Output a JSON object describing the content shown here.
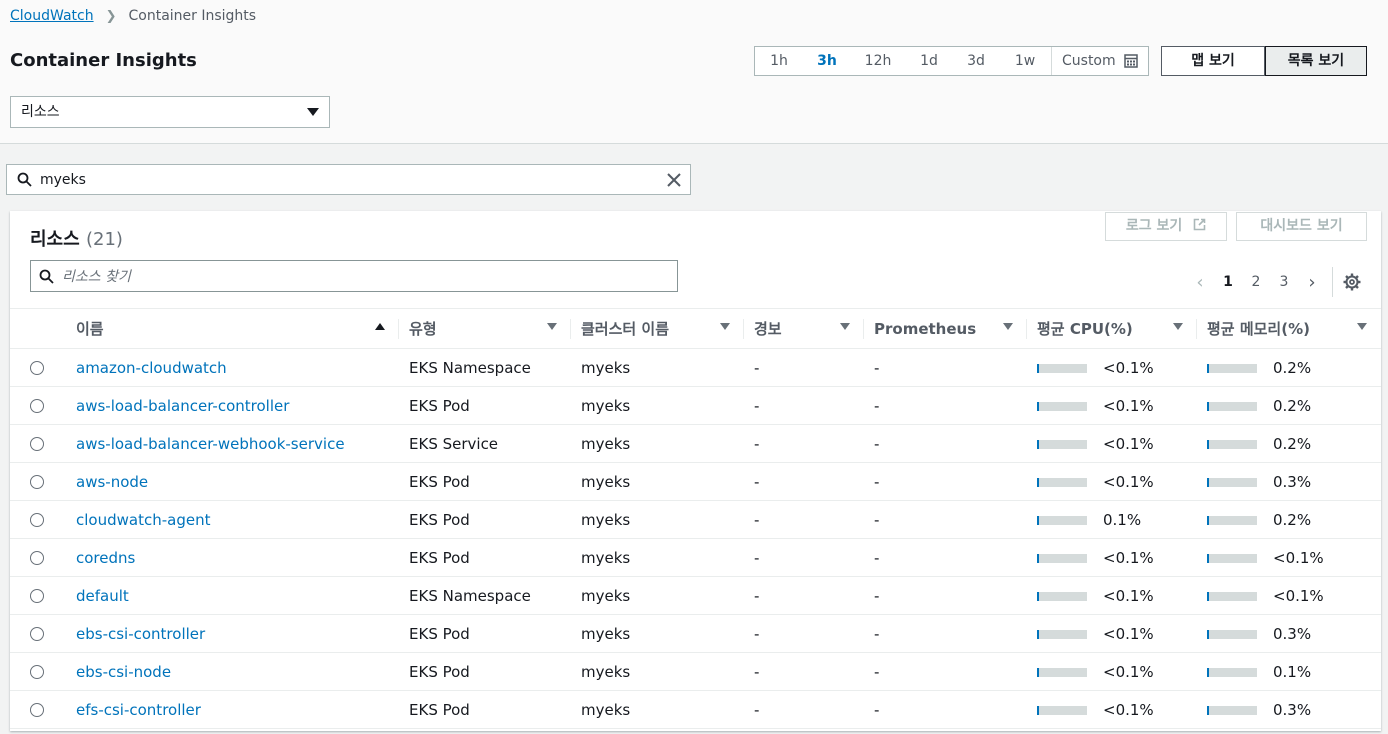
{
  "breadcrumb": {
    "root": "CloudWatch",
    "current": "Container Insights"
  },
  "page": {
    "title": "Container Insights"
  },
  "time_range": {
    "options": [
      "1h",
      "3h",
      "12h",
      "1d",
      "3d",
      "1w"
    ],
    "selected": "3h",
    "custom_label": "Custom"
  },
  "view_toggle": {
    "map": "맵 보기",
    "list": "목록 보기",
    "active": "list"
  },
  "resource_select": {
    "value": "리소스"
  },
  "filter": {
    "value": "myeks"
  },
  "panel": {
    "title": "리소스",
    "count": "(21)",
    "logs_button": "로그 보기",
    "dashboard_button": "대시보드 보기",
    "search_placeholder": "리소스 찾기"
  },
  "pagination": {
    "pages": [
      "1",
      "2",
      "3"
    ],
    "current": "1"
  },
  "table": {
    "columns": [
      "이름",
      "유형",
      "클러스터 이름",
      "경보",
      "Prometheus",
      "평균 CPU(%)",
      "평균 메모리(%)"
    ],
    "rows": [
      {
        "name": "amazon-cloudwatch",
        "type": "EKS Namespace",
        "cluster": "myeks",
        "alarm": "-",
        "prometheus": "-",
        "cpu": "<0.1%",
        "cpu_fill": 0.04,
        "mem": "0.2%",
        "mem_fill": 0.04
      },
      {
        "name": "aws-load-balancer-controller",
        "type": "EKS Pod",
        "cluster": "myeks",
        "alarm": "-",
        "prometheus": "-",
        "cpu": "<0.1%",
        "cpu_fill": 0.04,
        "mem": "0.2%",
        "mem_fill": 0.04
      },
      {
        "name": "aws-load-balancer-webhook-service",
        "type": "EKS Service",
        "cluster": "myeks",
        "alarm": "-",
        "prometheus": "-",
        "cpu": "<0.1%",
        "cpu_fill": 0.04,
        "mem": "0.2%",
        "mem_fill": 0.04
      },
      {
        "name": "aws-node",
        "type": "EKS Pod",
        "cluster": "myeks",
        "alarm": "-",
        "prometheus": "-",
        "cpu": "<0.1%",
        "cpu_fill": 0.04,
        "mem": "0.3%",
        "mem_fill": 0.04
      },
      {
        "name": "cloudwatch-agent",
        "type": "EKS Pod",
        "cluster": "myeks",
        "alarm": "-",
        "prometheus": "-",
        "cpu": "0.1%",
        "cpu_fill": 0.04,
        "mem": "0.2%",
        "mem_fill": 0.04
      },
      {
        "name": "coredns",
        "type": "EKS Pod",
        "cluster": "myeks",
        "alarm": "-",
        "prometheus": "-",
        "cpu": "<0.1%",
        "cpu_fill": 0.04,
        "mem": "<0.1%",
        "mem_fill": 0.04
      },
      {
        "name": "default",
        "type": "EKS Namespace",
        "cluster": "myeks",
        "alarm": "-",
        "prometheus": "-",
        "cpu": "<0.1%",
        "cpu_fill": 0.04,
        "mem": "<0.1%",
        "mem_fill": 0.04
      },
      {
        "name": "ebs-csi-controller",
        "type": "EKS Pod",
        "cluster": "myeks",
        "alarm": "-",
        "prometheus": "-",
        "cpu": "<0.1%",
        "cpu_fill": 0.04,
        "mem": "0.3%",
        "mem_fill": 0.04
      },
      {
        "name": "ebs-csi-node",
        "type": "EKS Pod",
        "cluster": "myeks",
        "alarm": "-",
        "prometheus": "-",
        "cpu": "<0.1%",
        "cpu_fill": 0.04,
        "mem": "0.1%",
        "mem_fill": 0.04
      },
      {
        "name": "efs-csi-controller",
        "type": "EKS Pod",
        "cluster": "myeks",
        "alarm": "-",
        "prometheus": "-",
        "cpu": "<0.1%",
        "cpu_fill": 0.04,
        "mem": "0.3%",
        "mem_fill": 0.04
      }
    ]
  },
  "colors": {
    "accent": "#0073bb",
    "bar_track": "#d5dbdb",
    "text": "#16191f"
  }
}
